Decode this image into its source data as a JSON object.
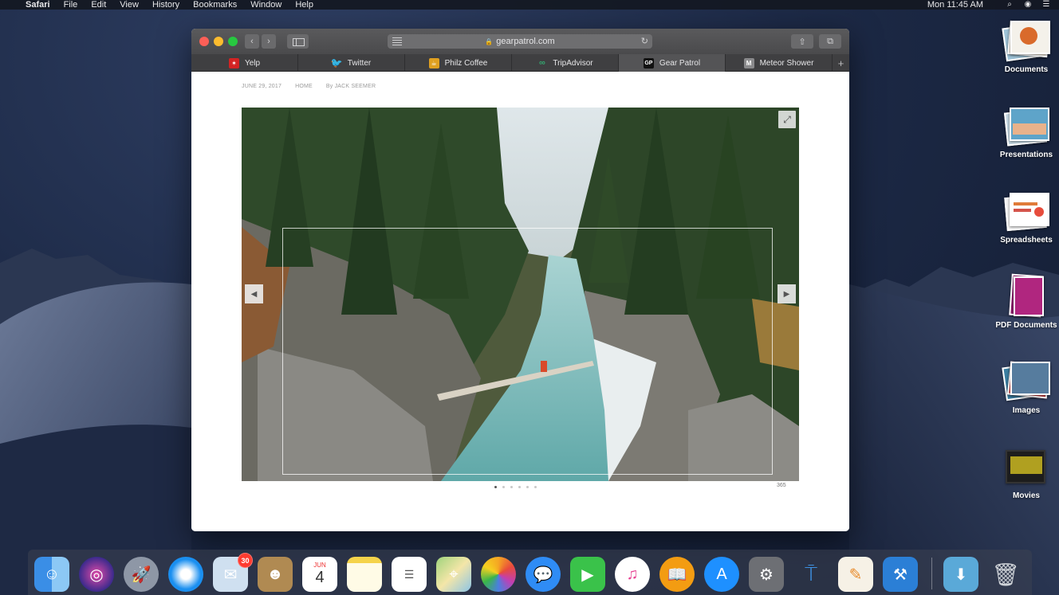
{
  "menubar": {
    "app_name": "Safari",
    "items": [
      "File",
      "Edit",
      "View",
      "History",
      "Bookmarks",
      "Window",
      "Help"
    ],
    "clock": "Mon 11:45 AM"
  },
  "browser": {
    "url": "gearpatrol.com",
    "tabs": [
      {
        "label": "Yelp",
        "icon": "yelp-icon",
        "color": "#d32323",
        "glyph": "✶"
      },
      {
        "label": "Twitter",
        "icon": "twitter-icon",
        "color": "#1da1f2",
        "glyph": "♦"
      },
      {
        "label": "Philz Coffee",
        "icon": "philz-coffee-icon",
        "color": "#e0a020",
        "glyph": "☕"
      },
      {
        "label": "TripAdvisor",
        "icon": "tripadvisor-icon",
        "color": "#34a56f",
        "glyph": "∞"
      },
      {
        "label": "Gear Patrol",
        "icon": "gear-patrol-icon",
        "color": "#111111",
        "glyph": "GP"
      },
      {
        "label": "Meteor Shower",
        "icon": "meteor-shower-icon",
        "color": "#8a8a8c",
        "glyph": "M"
      }
    ],
    "active_tab": 4
  },
  "article": {
    "date": "JUNE 29, 2017",
    "section": "HOME",
    "byline": "By JACK SEEMER",
    "credit": "365",
    "carousel_total": 6,
    "carousel_active": 0
  },
  "desktop_stacks": [
    {
      "label": "Documents",
      "icon": "documents-stack-icon"
    },
    {
      "label": "Presentations",
      "icon": "presentations-stack-icon"
    },
    {
      "label": "Spreadsheets",
      "icon": "spreadsheets-stack-icon"
    },
    {
      "label": "PDF Documents",
      "icon": "pdf-documents-stack-icon"
    },
    {
      "label": "Images",
      "icon": "images-stack-icon"
    },
    {
      "label": "Movies",
      "icon": "movies-stack-icon"
    }
  ],
  "dock": {
    "mail_badge": "30",
    "calendar_month": "JUN",
    "calendar_day": "4",
    "apps": [
      "finder-icon",
      "siri-icon",
      "launchpad-icon",
      "safari-icon",
      "mail-icon",
      "contacts-icon",
      "calendar-icon",
      "notes-icon",
      "reminders-icon",
      "maps-icon",
      "photos-icon",
      "messages-icon",
      "facetime-icon",
      "itunes-icon",
      "ibooks-icon",
      "app-store-icon",
      "system-preferences-icon",
      "keynote-icon",
      "pages-icon",
      "xcode-icon",
      "downloads-folder-icon",
      "trash-icon"
    ]
  }
}
